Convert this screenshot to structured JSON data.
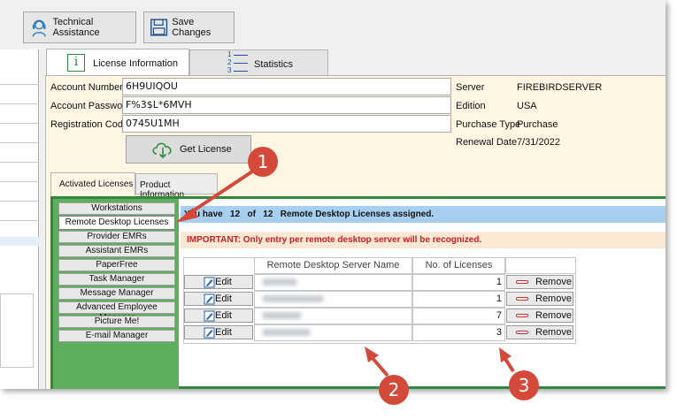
{
  "toolbar": {
    "tech_assist_label": "Technical Assistance",
    "save_changes_label": "Save Changes"
  },
  "tabs": {
    "license_info": "License Information",
    "statistics": "Statistics",
    "statistics_icon_numbers": [
      "1",
      "2",
      "3"
    ]
  },
  "account": {
    "number_label": "Account Number",
    "number_value": "6H9UIQOU",
    "password_label": "Account Password",
    "password_value": "F%3$L*6MVH",
    "registration_label": "Registration Code",
    "registration_value": "0745U1MH",
    "get_license_label": "Get License"
  },
  "server_info": {
    "server_label": "Server",
    "server_value": "FIREBIRDSERVER",
    "edition_label": "Edition",
    "edition_value": "USA",
    "purchase_type_label": "Purchase Type",
    "purchase_type_value": "Purchase",
    "renewal_label": "Renewal Date",
    "renewal_value": "7/31/2022"
  },
  "subtabs": {
    "activated": "Activated Licenses",
    "product_info": "Product Information"
  },
  "sidebar_items": [
    "Workstations",
    "Remote Desktop Licenses",
    "Provider EMRs",
    "Assistant EMRs",
    "PaperFree",
    "Task Manager",
    "Message Manager",
    "Advanced Employee Manager",
    "Picture Me!",
    "E-mail Manager"
  ],
  "banner": {
    "assigned_text": "You have   12   of   12   Remote Desktop Licenses assigned.",
    "important_text": "IMPORTANT: Only entry per remote desktop server will be recognized."
  },
  "table": {
    "col_server": "Remote Desktop Server Name",
    "col_licenses": "No. of Licenses",
    "edit_label": "Edit",
    "remove_label": "Remove",
    "rows": [
      {
        "licenses": "1"
      },
      {
        "licenses": "1"
      },
      {
        "licenses": "7"
      },
      {
        "licenses": "3"
      }
    ]
  },
  "callouts": [
    "1",
    "2",
    "3"
  ],
  "colors": {
    "accent_green": "#2e8b3e",
    "banner_blue": "#a6cff0",
    "important_red": "#cc2020",
    "callout_red": "#d44a3a",
    "form_bg": "#fdf6e3"
  }
}
